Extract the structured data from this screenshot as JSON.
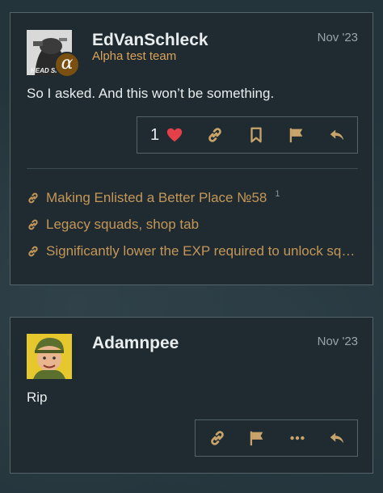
{
  "posts": [
    {
      "username": "EdVanSchleck",
      "user_title": "Alpha test team",
      "badge_glyph": "α",
      "avatar_text": "HEAD SH",
      "date": "Nov '23",
      "body": "So I asked. And this won’t be something.",
      "like_count": "1",
      "linked_topics": [
        {
          "title": "Making Enlisted a Better Place №58",
          "count": "1"
        },
        {
          "title": "Legacy squads, shop tab",
          "count": ""
        },
        {
          "title": "Significantly lower the EXP required to unlock squ...",
          "count": ""
        }
      ]
    },
    {
      "username": "Adamnpee",
      "date": "Nov '23",
      "body": "Rip"
    }
  ],
  "colors": {
    "accent_link": "#c49758",
    "heart": "#e5404a",
    "icon": "#c9a46a",
    "background": "#24343b",
    "card": "#1f2b31"
  },
  "icons": {
    "post1_actions": [
      "heart-icon",
      "link-icon",
      "bookmark-icon",
      "flag-icon",
      "reply-icon"
    ],
    "post2_actions": [
      "link-icon",
      "flag-icon",
      "more-icon",
      "reply-icon"
    ]
  }
}
